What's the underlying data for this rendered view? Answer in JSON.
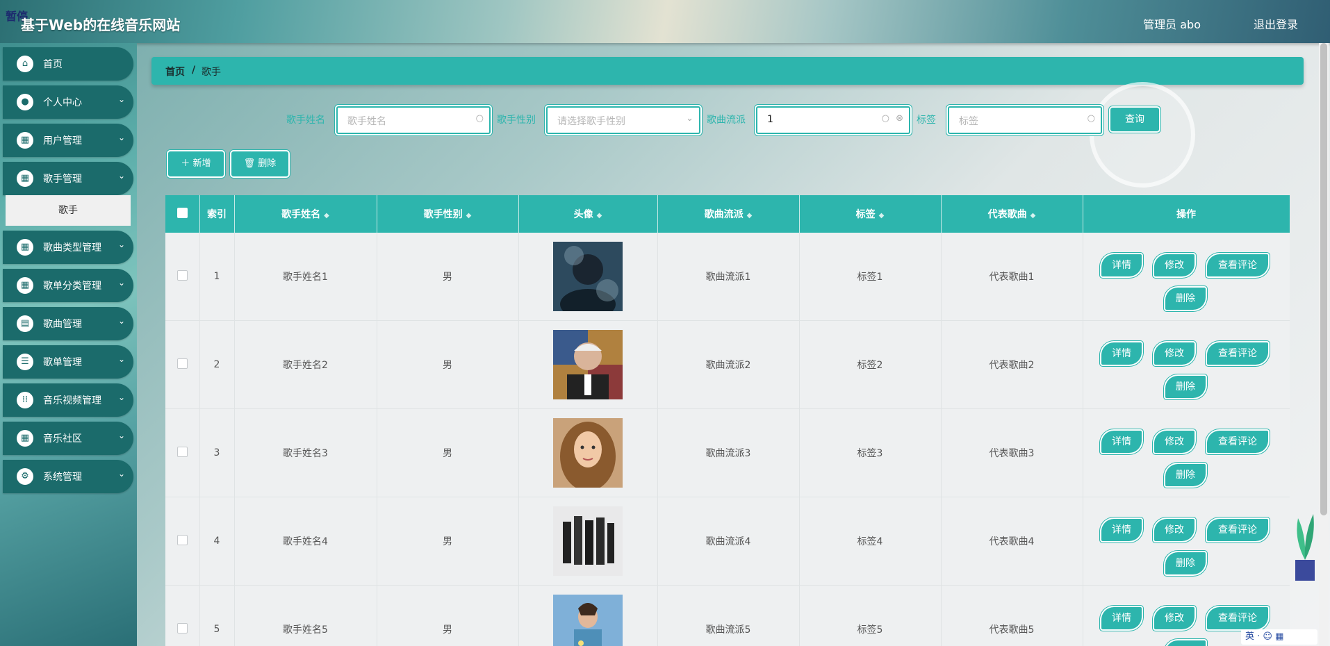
{
  "header": {
    "brand_tag": "暂停",
    "site_title": "基于Web的在线音乐网站",
    "admin_label": "管理员 abo",
    "logout": "退出登录"
  },
  "sidebar": {
    "items": [
      {
        "label": "首页",
        "icon": "home-icon",
        "expandable": false
      },
      {
        "label": "个人中心",
        "icon": "user-icon",
        "expandable": true
      },
      {
        "label": "用户管理",
        "icon": "grid-icon",
        "expandable": true
      },
      {
        "label": "歌手管理",
        "icon": "grid-icon",
        "expandable": true
      },
      {
        "label": "歌曲类型管理",
        "icon": "grid-icon",
        "expandable": true
      },
      {
        "label": "歌单分类管理",
        "icon": "grid-icon",
        "expandable": true
      },
      {
        "label": "歌曲管理",
        "icon": "card-icon",
        "expandable": true
      },
      {
        "label": "歌单管理",
        "icon": "list-icon",
        "expandable": true
      },
      {
        "label": "音乐视频管理",
        "icon": "apps-icon",
        "expandable": true
      },
      {
        "label": "音乐社区",
        "icon": "grid-icon",
        "expandable": true
      },
      {
        "label": "系统管理",
        "icon": "settings-icon",
        "expandable": true
      }
    ],
    "sub_item": "歌手"
  },
  "breadcrumb": {
    "home": "首页",
    "separator": "/",
    "current": "歌手"
  },
  "search": {
    "name_label": "歌手姓名",
    "name_placeholder": "歌手姓名",
    "gender_label": "歌手性别",
    "gender_placeholder": "请选择歌手性别",
    "genre_label": "歌曲流派",
    "genre_value": "1",
    "tag_label": "标签",
    "tag_placeholder": "标签",
    "query_button": "查询"
  },
  "actions": {
    "add": "＋ 新增",
    "delete": "🗑 删除"
  },
  "table": {
    "headers": [
      "索引",
      "歌手姓名",
      "歌手性别",
      "头像",
      "歌曲流派",
      "标签",
      "代表歌曲",
      "操作"
    ],
    "rows": [
      {
        "index": "1",
        "name": "歌手姓名1",
        "gender": "男",
        "genre": "歌曲流派1",
        "tag": "标签1",
        "song": "代表歌曲1"
      },
      {
        "index": "2",
        "name": "歌手姓名2",
        "gender": "男",
        "genre": "歌曲流派2",
        "tag": "标签2",
        "song": "代表歌曲2"
      },
      {
        "index": "3",
        "name": "歌手姓名3",
        "gender": "男",
        "genre": "歌曲流派3",
        "tag": "标签3",
        "song": "代表歌曲3"
      },
      {
        "index": "4",
        "name": "歌手姓名4",
        "gender": "男",
        "genre": "歌曲流派4",
        "tag": "标签4",
        "song": "代表歌曲4"
      },
      {
        "index": "5",
        "name": "歌手姓名5",
        "gender": "男",
        "genre": "歌曲流派5",
        "tag": "标签5",
        "song": "代表歌曲5"
      }
    ],
    "row_ops": {
      "detail": "详情",
      "edit": "修改",
      "review": "查看评论",
      "delete": "删除"
    }
  },
  "ime": {
    "label": "英"
  },
  "colors": {
    "accent": "#2db5ad",
    "nav": "#1b6b6b"
  }
}
